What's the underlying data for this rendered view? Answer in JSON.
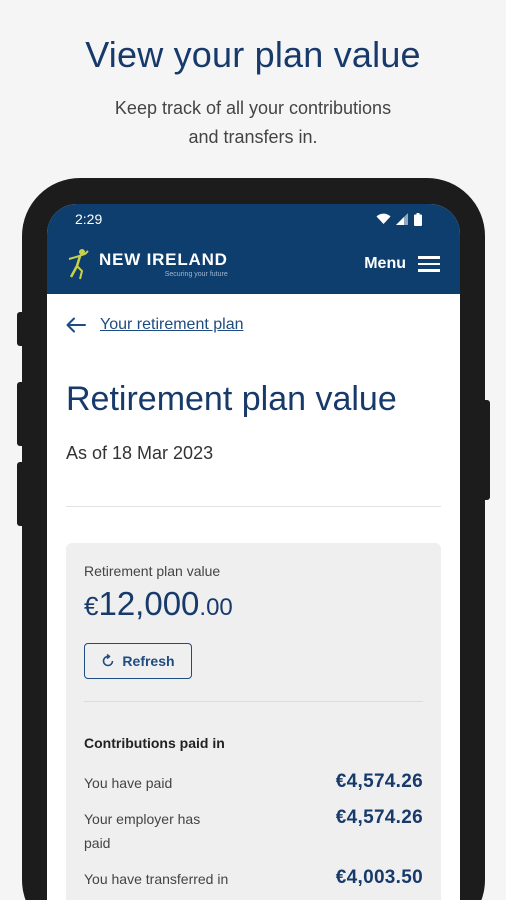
{
  "promo": {
    "title": "View your plan value",
    "subtitle_line1": "Keep track of all your contributions",
    "subtitle_line2": "and transfers in."
  },
  "status_bar": {
    "time": "2:29"
  },
  "header": {
    "logo_text": "NEW IRELAND",
    "logo_tagline": "Securing your future",
    "menu_label": "Menu"
  },
  "nav": {
    "back_label": "Your retirement plan"
  },
  "page": {
    "title": "Retirement plan value",
    "as_of": "As of 18 Mar 2023"
  },
  "plan_value": {
    "label": "Retirement plan value",
    "currency": "€",
    "whole": "12,000",
    "cents": ".00",
    "refresh_label": "Refresh"
  },
  "contributions": {
    "title": "Contributions paid in",
    "rows": [
      {
        "label": "You have paid",
        "value": "€4,574.26"
      },
      {
        "label": "Your employer has paid",
        "value": "€4,574.26"
      },
      {
        "label": "You have transferred in",
        "value": "€4,003.50"
      }
    ]
  },
  "colors": {
    "brand_navy": "#0d3e6e",
    "accent_text": "#173a6b",
    "logo_yellow": "#c7d24a"
  },
  "icons": [
    "wifi-icon",
    "signal-icon",
    "battery-icon",
    "back-arrow-icon",
    "refresh-icon",
    "hamburger-icon",
    "logo-figure-icon"
  ]
}
